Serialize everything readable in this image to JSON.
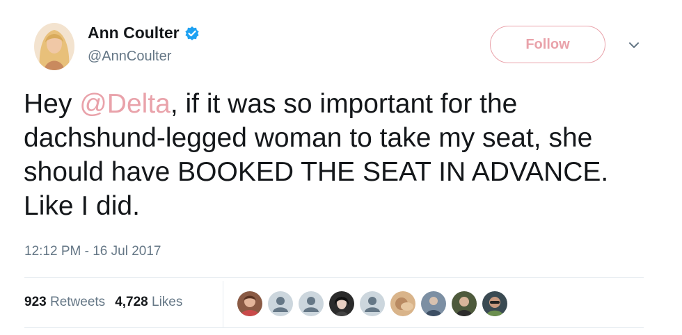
{
  "user": {
    "name": "Ann Coulter",
    "handle": "@AnnCoulter",
    "verified_icon": "verified-badge-icon"
  },
  "follow_label": "Follow",
  "tweet": {
    "text_before": "Hey ",
    "mention": "@Delta",
    "text_after": ", if it was so important for the dachshund-legged woman to take my seat, she should have BOOKED THE SEAT IN ADVANCE. Like I did."
  },
  "timestamp": "12:12 PM - 16 Jul 2017",
  "stats": {
    "retweets_count": "923",
    "retweets_label": "Retweets",
    "likes_count": "4,728",
    "likes_label": "Likes"
  },
  "colors": {
    "accent": "#e9a2aa",
    "verified": "#1da1f2",
    "muted": "#657786",
    "divider": "#e6ecf0"
  }
}
